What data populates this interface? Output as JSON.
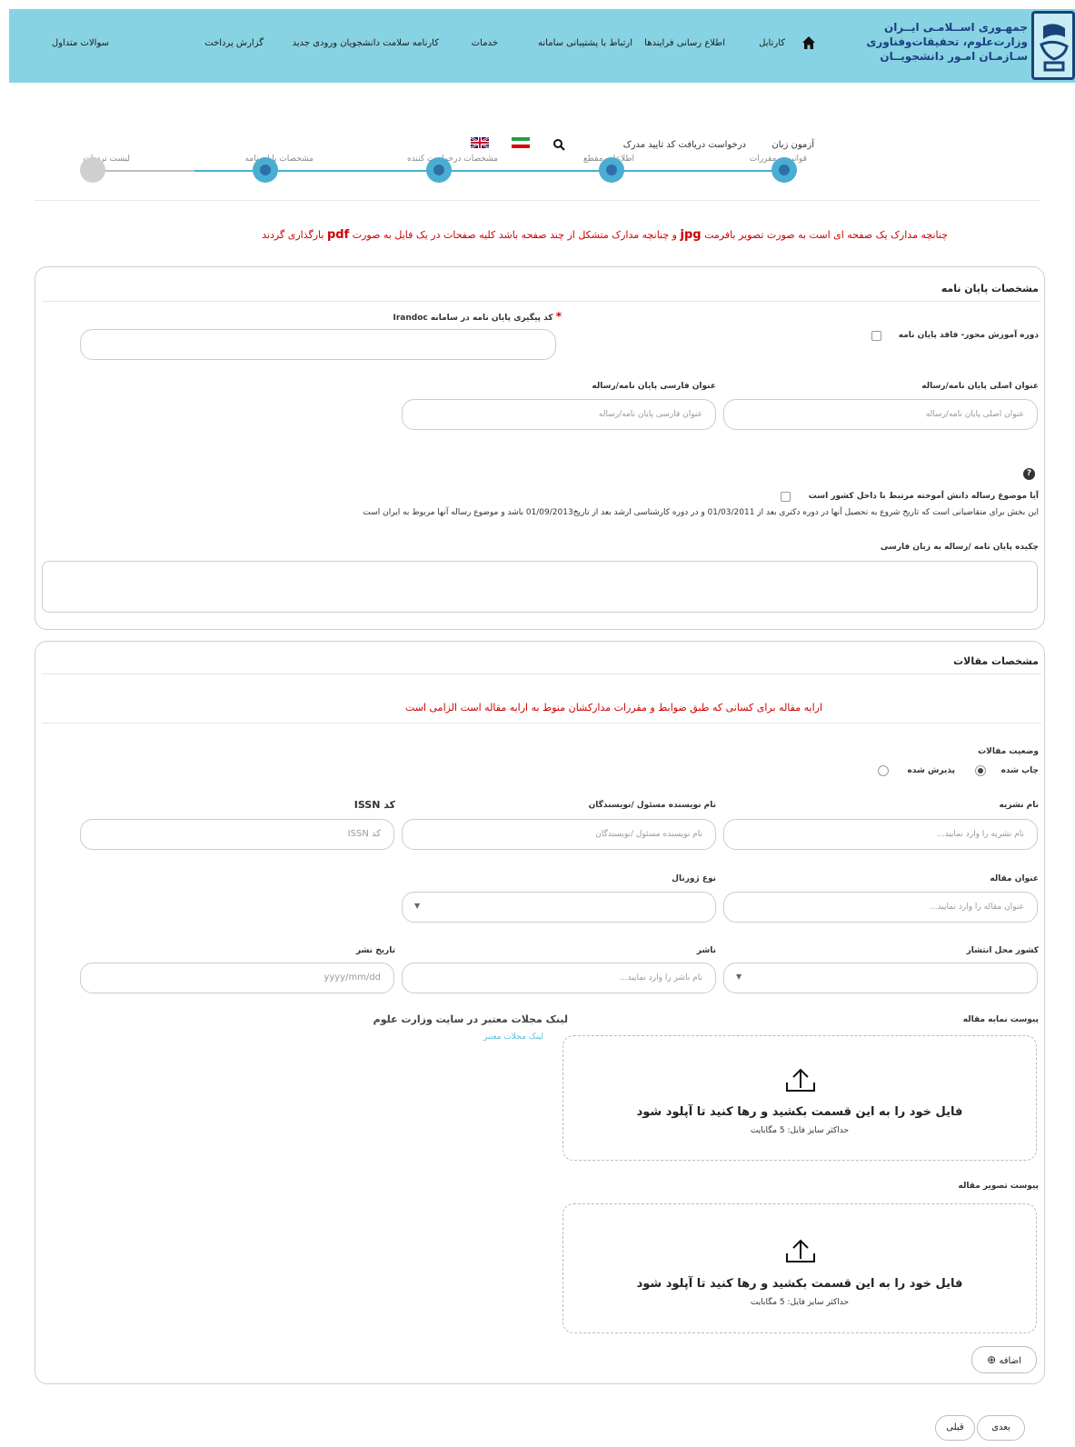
{
  "header": {
    "logo_lines": [
      "جمهـوری اســلامـی ایــران",
      "وزارت‌علوم، تحقیقات‌وفناوری",
      "سـازمـان امـور دانشجویــان"
    ],
    "nav": [
      "کارتابل",
      "اطلاع رسانی فرایندها",
      "ارتباط با پشتیبانی سامانه",
      "خدمات",
      "کارنامه سلامت دانشجویان ورودی جدید",
      "گزارش پرداخت",
      "سوالات متداول"
    ]
  },
  "stepper": {
    "top_links": [
      "آزمون زبان",
      "درخواست دریافت کد تایید مدرک"
    ],
    "steps": [
      {
        "label": "قوانین و مقررات"
      },
      {
        "label": "اطلاعات مقطع"
      },
      {
        "label": "مشخصات درخواست کننده"
      },
      {
        "label": "مشخصات پایان نامه"
      },
      {
        "label": "لیست ترددات"
      }
    ]
  },
  "notice": {
    "part1": "چنانچه مدارک یک صفحه ای است به صورت تصویر بافرمت",
    "jpg": "jpg",
    "part2": "و چنانچه مدارک متشکل از چند صفحه باشد کلیه صفحات در یک فایل به صورت",
    "pdf": "pdf",
    "part3": "بارگذاری گردند"
  },
  "thesis": {
    "title": "مشخصات پایان نامه",
    "course_only_label": "دوره آموزش محور- فاقد پایان نامه",
    "irandoc_label": "کد پیگیری پایان نامه در سامانه Irandoc",
    "required_mark": "*",
    "irandoc_value": "",
    "main_title_label": "عنوان اصلی پایان نامه/رساله",
    "main_title_placeholder": "عنوان اصلی پایان نامه/رساله",
    "persian_title_label": "عنوان فارسی پایان نامه/رساله",
    "persian_title_placeholder": "عنوان فارسی پایان نامه/رساله",
    "help_glyph": "?",
    "domestic_question": "آیا موضوع رساله دانش آموخته مرتبط با داخل کشور است",
    "domestic_note": "این بخش برای متقاضیانی است که تاریخ شروع به تحصیل آنها در دوره دکتری بعد از 01/03/2011 و در دوره کارشناسی ارشد بعد از تاریخ01/09/2013 باشد و موضوع رساله آنها مربوط به ایران است",
    "abstract_label": "چکیده پایان نامه /رساله به زبان فارسی"
  },
  "articles": {
    "title": "مشخصات مقالات",
    "notice": "ارایه مقاله برای کسانی که طبق ضوابط و مقررات مدارکشان منوط به ارایه مقاله است الزامی است",
    "status_label": "وضعیت مقالات",
    "status_options": [
      {
        "label": "چاپ شده",
        "checked": true
      },
      {
        "label": "پذیرش شده",
        "checked": false
      }
    ],
    "journal_name_label": "نام نشریه",
    "journal_name_placeholder": "نام نشریه را وارد نمایید...",
    "author_label": "نام نویسنده مسئول /نویسندگان",
    "author_placeholder": "نام نویسنده مسئول /نویسندگان",
    "issn_label": "کد ISSN",
    "issn_placeholder": "کد ISSN",
    "article_title_label": "عنوان مقاله",
    "article_title_placeholder": "عنوان مقاله را وارد نمایید...",
    "journal_type_label": "نوع ژورنال",
    "country_label": "کشور محل انتشار",
    "publisher_label": "ناشر",
    "publisher_placeholder": "نام ناشر را وارد نمایید...",
    "pub_date_label": "تاریخ نشر",
    "pub_date_placeholder": "yyyy/mm/dd",
    "index_attach_label": "پیوست نمایه مقاله",
    "valid_journals_title": "لینک مجلات معتبر در سایت وزارت علوم",
    "valid_journals_link": "لینک مجلات معتبر",
    "image_attach_label": "پیوست تصویر مقاله",
    "drop_main": "فایل خود را به این قسمت بکشید و رها کنید تا آپلود شود",
    "drop_sub": "حداکثر سایز فایل: 5 مگابایت",
    "add_button": "اضافه"
  },
  "footer": {
    "next": "بعدی",
    "prev": "قبلی"
  },
  "colors": {
    "header_bg": "#87d3e3",
    "step_active": "#4aaed2",
    "step_inactive": "#cfcfcf",
    "notice_red": "#d10000",
    "link": "#5bc0de"
  }
}
